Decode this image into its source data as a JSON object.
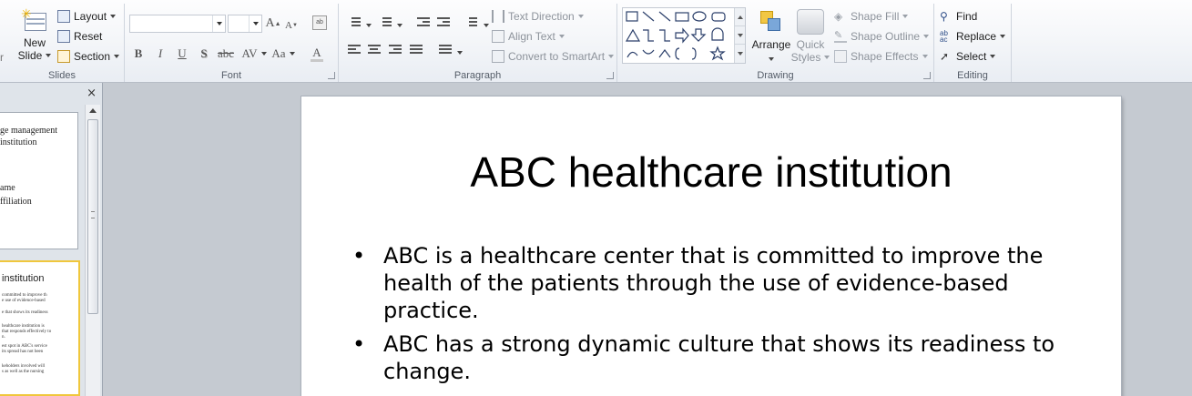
{
  "ribbon": {
    "slides_group": {
      "new_slide_label_1": "New",
      "new_slide_label_2": "Slide",
      "layout": "Layout",
      "reset": "Reset",
      "section": "Section",
      "group_label": "Slides",
      "left_fragment": "r"
    },
    "font_group": {
      "font_name": "",
      "font_size": "",
      "grow": "A",
      "shrink": "A",
      "bold": "B",
      "italic": "I",
      "underline": "U",
      "shadow": "S",
      "strike": "abc",
      "spacing": "AV",
      "change_case": "Aa",
      "font_color": "A",
      "group_label": "Font"
    },
    "paragraph_group": {
      "text_direction": "Text Direction",
      "align_text": "Align Text",
      "convert_smartart": "Convert to SmartArt",
      "group_label": "Paragraph"
    },
    "drawing_group": {
      "arrange": "Arrange",
      "quick_styles_1": "Quick",
      "quick_styles_2": "Styles",
      "shape_fill": "Shape Fill",
      "shape_outline": "Shape Outline",
      "shape_effects": "Shape Effects",
      "group_label": "Drawing"
    },
    "editing_group": {
      "find": "Find",
      "replace": "Replace",
      "select": "Select",
      "group_label": "Editing"
    }
  },
  "thumbnails": {
    "close_glyph": "×",
    "slide1": {
      "line1": "ge management",
      "line2": "institution",
      "line3": "ame",
      "line4": "ffiliation"
    },
    "slide2": {
      "title": "institution",
      "lines": [
        "committed to improve th",
        "e use of evidence-based",
        "e that shows its readiness",
        "healthcare institution is",
        "that responds effectively to",
        "n.",
        "est spot in ABC's service",
        "its spread has not been",
        "keholders involved will",
        "s as well as the nursing"
      ]
    }
  },
  "slide": {
    "title": "ABC healthcare institution",
    "bullets": [
      "ABC is a healthcare center that is committed to improve the health of the patients through the use of evidence-based practice.",
      "ABC has a strong dynamic culture that shows its readiness to change."
    ]
  }
}
